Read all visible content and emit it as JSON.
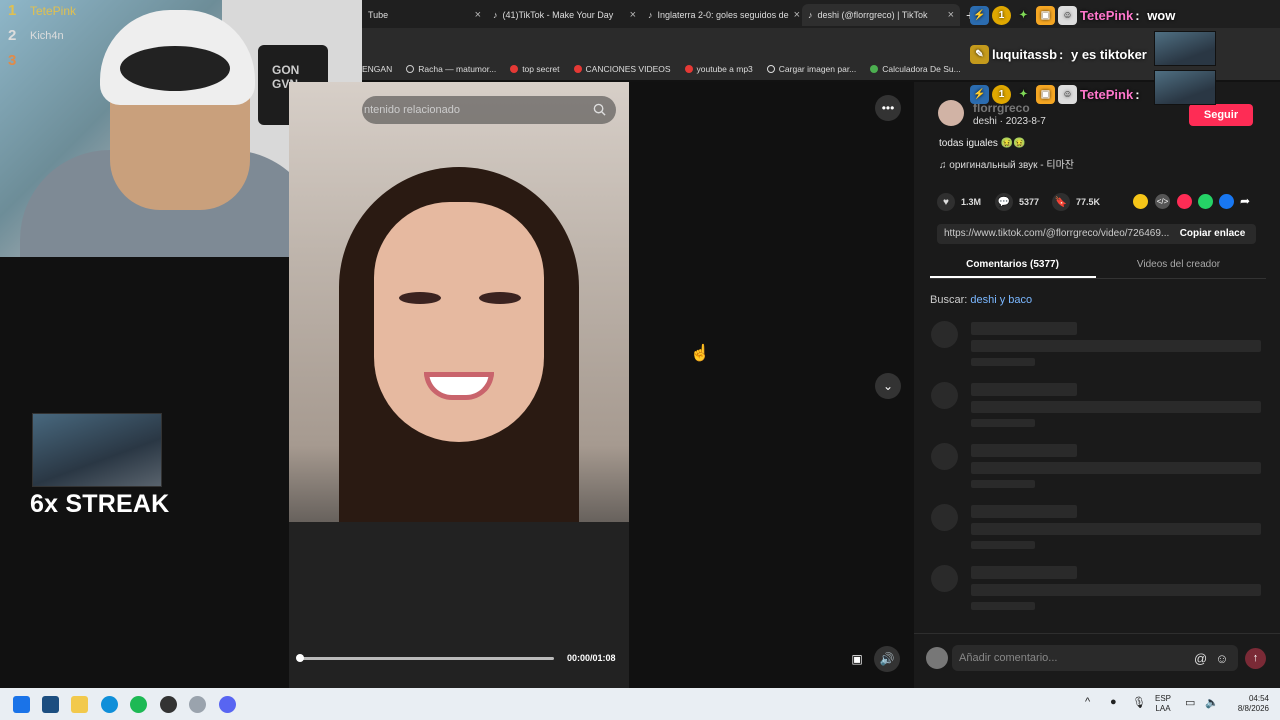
{
  "webcam": {
    "leaderboard": [
      {
        "rank": "1",
        "name": "TetePink",
        "color": "#e0c050"
      },
      {
        "rank": "2",
        "name": "Kich4n",
        "color": "#dddddd"
      },
      {
        "rank": "3",
        "name": "",
        "color": "#e08b4a"
      }
    ],
    "shirt_text": "GON\nGVN"
  },
  "browser": {
    "tabs": [
      {
        "label": "Tube",
        "close": "×"
      },
      {
        "label": "(41)TikTok - Make Your Day",
        "close": "×"
      },
      {
        "label": "Inglaterra 2-0: goles seguidos de",
        "close": "×"
      },
      {
        "label": "deshi (@florrgreco) | TikTok",
        "close": "×"
      }
    ],
    "new_tab": "+",
    "bookmarks": [
      {
        "label": "ENGAN",
        "color": "#888888"
      },
      {
        "label": "Racha — matumor...",
        "color": "#cccccc"
      },
      {
        "label": "top secret",
        "color": "#e53935"
      },
      {
        "label": "CANCIONES VIDEOS",
        "color": "#e53935"
      },
      {
        "label": "youtube a mp3",
        "color": "#e53935"
      },
      {
        "label": "Cargar imagen par...",
        "color": "#dddddd"
      },
      {
        "label": "Calculadora De Su...",
        "color": "#4caf50"
      }
    ]
  },
  "stream": {
    "streak_label": "6x STREAK"
  },
  "video": {
    "search_placeholder": "ntenido relacionado",
    "time": "00:00/01:08",
    "progress": 0
  },
  "post": {
    "username": "florrgreco",
    "user_date": "deshi · 2023-8-7",
    "follow_label": "Seguir",
    "caption": "todas iguales 🤢🤢",
    "sound": "♫  оригинальный звук - 티마잔",
    "likes": "1.3M",
    "comments": "5377",
    "saves": "77.5K",
    "link": "https://www.tiktok.com/@florrgreco/video/726469...",
    "copy_label": "Copiar enlace",
    "tabs": [
      "Comentarios (5377)",
      "Videos del creador"
    ],
    "search_prefix": "Buscar: ",
    "search_query": "deshi y baco",
    "comment_placeholder": "Añadir comentario...",
    "share_colors": [
      "#f5c518",
      "#555555",
      "#fe2c55",
      "#25d366",
      "#1877f2",
      "#333333"
    ]
  },
  "chat": [
    {
      "user": "TetePink",
      "sep": ":",
      "msg": "wow",
      "color": "#ff77cc"
    },
    {
      "user": "luquitassb",
      "sep": ":",
      "msg": "y es tiktoker",
      "color": "#ffffff"
    },
    {
      "user": "TetePink",
      "sep": ":",
      "msg": "",
      "color": "#ff77cc"
    }
  ],
  "badges": [
    "1"
  ],
  "taskbar": {
    "lang": "ESP",
    "layout": "LAA",
    "time": "04:54",
    "date": "8/8/2026"
  }
}
